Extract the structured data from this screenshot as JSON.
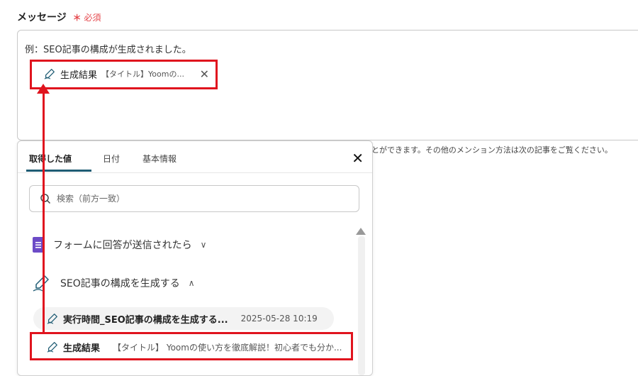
{
  "field": {
    "label": "メッセージ",
    "required_star": "＊",
    "required_text": "必須"
  },
  "message": {
    "example_text": "例：SEO記事の構成が生成されました。",
    "chip_label": "生成結果",
    "chip_detail": "【タイトル】Yoomの..."
  },
  "hint_text": "とができます。その他のメンション方法は次の記事をご覧ください。",
  "panel": {
    "tabs": [
      {
        "label": "取得した値"
      },
      {
        "label": "日付"
      },
      {
        "label": "基本情報"
      }
    ],
    "search_placeholder": "検索（前方一致）",
    "sections": [
      {
        "label": "フォームに回答が送信されたら"
      },
      {
        "label": "SEO記事の構成を生成する"
      }
    ],
    "items": [
      {
        "title": "実行時間_SEO記事の構成を生成する...",
        "value": "2025-05-28 10:19"
      },
      {
        "title": "生成結果",
        "value": "【タイトル】 Yoomの使い方を徹底解説！初心者でも分か..."
      }
    ]
  },
  "colors": {
    "highlight": "#e0141e",
    "tab_accent": "#1f5c74",
    "form_icon": "#6c4bc7",
    "required": "#e5484d"
  }
}
